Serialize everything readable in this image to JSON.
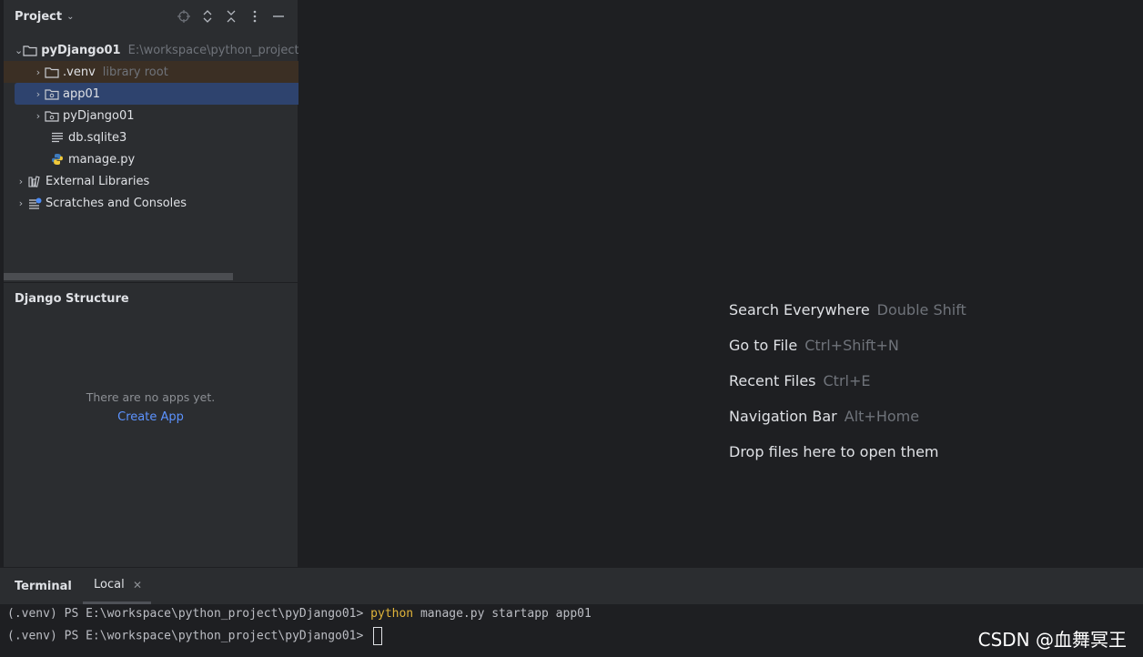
{
  "project_panel": {
    "title": "Project",
    "tree": [
      {
        "label": "pyDjango01",
        "hint": "E:\\workspace\\python_project\\",
        "expanded": true,
        "icon": "folder-icon"
      },
      {
        "label": ".venv",
        "hint": "library root",
        "icon": "folder-icon"
      },
      {
        "label": "app01",
        "icon": "package-folder-icon",
        "selected": true
      },
      {
        "label": "pyDjango01",
        "icon": "package-folder-icon"
      },
      {
        "label": "db.sqlite3",
        "icon": "text-file-icon"
      },
      {
        "label": "manage.py",
        "icon": "python-file-icon"
      },
      {
        "label": "External Libraries",
        "icon": "library-icon"
      },
      {
        "label": "Scratches and Consoles",
        "icon": "scratches-icon"
      }
    ]
  },
  "django_structure": {
    "title": "Django Structure",
    "empty_text": "There are no apps yet.",
    "create_link": "Create App"
  },
  "editor_hints": [
    {
      "label": "Search Everywhere",
      "shortcut": "Double Shift"
    },
    {
      "label": "Go to File",
      "shortcut": "Ctrl+Shift+N"
    },
    {
      "label": "Recent Files",
      "shortcut": "Ctrl+E"
    },
    {
      "label": "Navigation Bar",
      "shortcut": "Alt+Home"
    },
    {
      "label": "Drop files here to open them",
      "shortcut": ""
    }
  ],
  "terminal": {
    "title": "Terminal",
    "tab": "Local",
    "prompt": "(.venv) PS E:\\workspace\\python_project\\pyDjango01> ",
    "command_keyword": "python",
    "command_rest": " manage.py startapp app01"
  },
  "watermark": "CSDN @血舞冥王",
  "colors": {
    "selection": "#2e436e",
    "link": "#5c93ff",
    "command": "#e0b43a"
  }
}
